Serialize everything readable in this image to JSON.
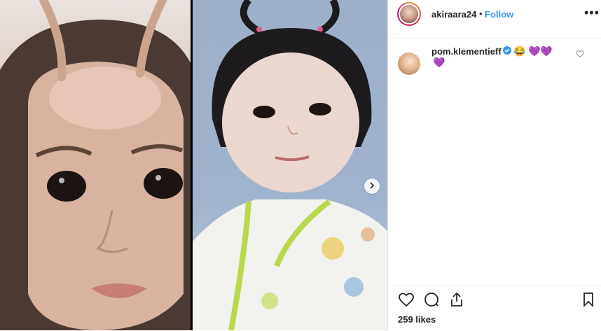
{
  "post": {
    "username": "akiraara24",
    "separator": "•",
    "follow_label": "Follow",
    "more_label": "•••",
    "likes": "259 likes"
  },
  "comment": {
    "username": "pom.klementieff",
    "emoji_1": "😂",
    "emoji_2": "💜",
    "emoji_3": "💜",
    "emoji_4": "💜"
  },
  "icons": {
    "heart": "heart-icon",
    "comment": "comment-bubble-icon",
    "share": "share-icon",
    "save": "bookmark-icon",
    "next": "chevron-right-icon",
    "verified": "verified-badge-icon"
  },
  "colors": {
    "accent": "#3897f0",
    "text": "#262626"
  }
}
